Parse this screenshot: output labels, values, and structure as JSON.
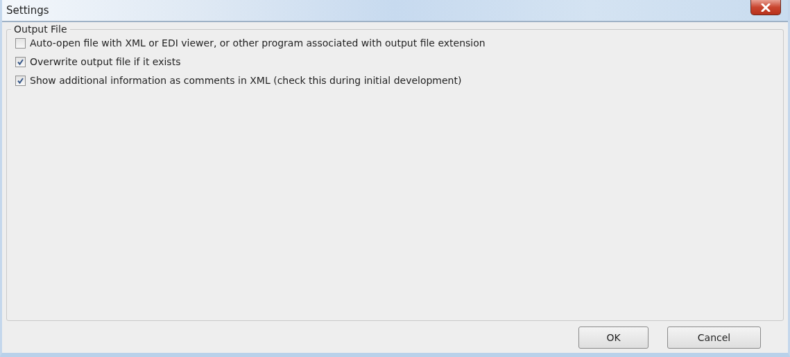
{
  "window": {
    "title": "Settings"
  },
  "group": {
    "title": "Output File",
    "options": [
      {
        "label": "Auto-open file with XML or EDI viewer, or other program associated with output file extension",
        "checked": false
      },
      {
        "label": "Overwrite output file if it exists",
        "checked": true
      },
      {
        "label": "Show additional information as comments in XML (check this during initial development)",
        "checked": true
      }
    ]
  },
  "buttons": [
    "OK",
    "Cancel"
  ]
}
